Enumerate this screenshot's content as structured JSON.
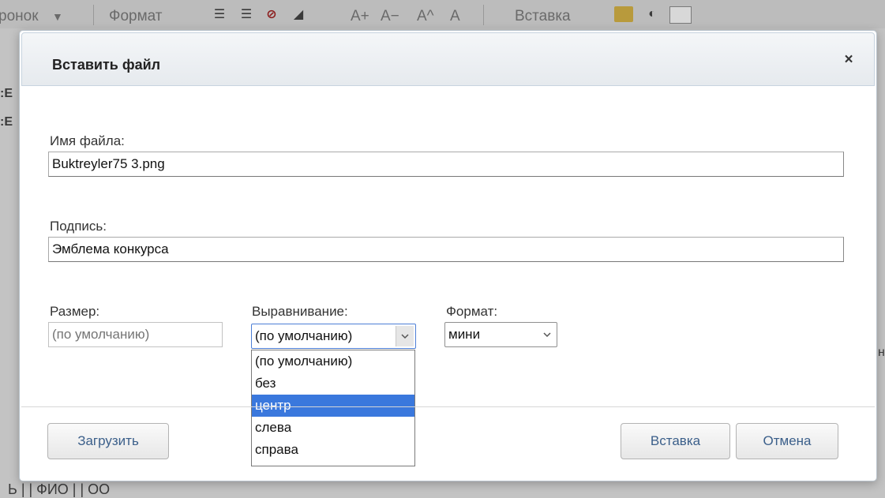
{
  "background": {
    "toolbar": {
      "heading_select": "ронок",
      "format_label": "Формат",
      "font_size_up": "A+",
      "font_size_down": "A−",
      "superscript": "A^",
      "plain": "A",
      "insert_label": "Вставка"
    },
    "bottom_text": "Ь  | |  ФИО  | |  ОО",
    "edge_chars": {
      "left": [
        ":Е",
        ":Е"
      ],
      "right": "н"
    }
  },
  "dialog": {
    "title": "Вставить файл",
    "close_glyph": "×",
    "filename": {
      "label": "Имя файла:",
      "value": "Buktreyler75 3.png"
    },
    "caption": {
      "label": "Подпись:",
      "value": "Эмблема конкурса"
    },
    "size": {
      "label": "Размер:",
      "placeholder": "(по умолчанию)"
    },
    "alignment": {
      "label": "Выравнивание:",
      "value": "(по умолчанию)",
      "options": [
        "(по умолчанию)",
        "без",
        "центр",
        "слева",
        "справа"
      ],
      "highlighted": "центр"
    },
    "format": {
      "label": "Формат:",
      "value": "мини"
    },
    "buttons": {
      "upload": "Загрузить",
      "insert": "Вставка",
      "cancel": "Отмена"
    }
  },
  "icons": {
    "close": "close-icon",
    "chevron": "chevron-down-icon"
  },
  "colors": {
    "highlight": "#3a78dd",
    "button_text": "#3b5f8a",
    "focus_border": "#4d7fd6"
  }
}
